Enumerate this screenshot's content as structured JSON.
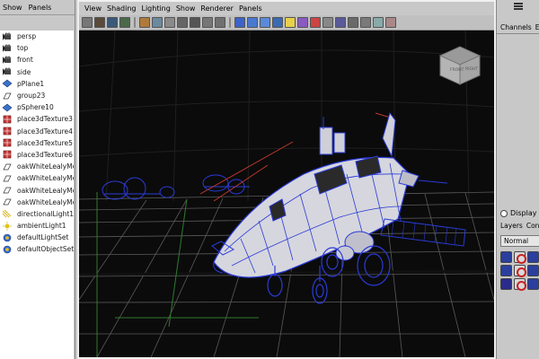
{
  "outliner": {
    "menu": [
      "Show",
      "Panels"
    ],
    "items": [
      {
        "label": "persp",
        "icon": "camera-icon"
      },
      {
        "label": "top",
        "icon": "camera-icon"
      },
      {
        "label": "front",
        "icon": "camera-icon"
      },
      {
        "label": "side",
        "icon": "camera-icon"
      },
      {
        "label": "pPlane1",
        "icon": "polygon-plane-icon"
      },
      {
        "label": "group23",
        "icon": "group-icon"
      },
      {
        "label": "pSphere10",
        "icon": "polygon-plane-icon"
      },
      {
        "label": "place3dTexture3",
        "icon": "texture-cube-icon"
      },
      {
        "label": "place3dTexture4",
        "icon": "texture-cube-icon"
      },
      {
        "label": "place3dTexture5",
        "icon": "texture-cube-icon"
      },
      {
        "label": "place3dTexture6",
        "icon": "texture-cube-icon"
      },
      {
        "label": "oakWhiteLealyMed",
        "icon": "group-icon"
      },
      {
        "label": "oakWhiteLealyMed",
        "icon": "group-icon"
      },
      {
        "label": "oakWhiteLealyMed",
        "icon": "group-icon"
      },
      {
        "label": "oakWhiteLealyMed",
        "icon": "group-icon"
      },
      {
        "label": "directionalLight1",
        "icon": "directional-light-icon"
      },
      {
        "label": "ambientLight1",
        "icon": "ambient-light-icon"
      },
      {
        "label": "defaultLightSet",
        "icon": "set-icon"
      },
      {
        "label": "defaultObjectSet",
        "icon": "set-icon"
      }
    ]
  },
  "viewport": {
    "menu": [
      "View",
      "Shading",
      "Lighting",
      "Show",
      "Renderer",
      "Panels"
    ],
    "viewcube": {
      "left_face": "FRONT",
      "right_face": "RIGHT"
    }
  },
  "right_panel": {
    "tabs": [
      "Channels",
      "E"
    ],
    "display_label": "Display",
    "layer_tabs": [
      "Layers",
      "Con"
    ],
    "blend_mode": "Normal"
  },
  "colors": {
    "viewport_bg": "#0b0b0b",
    "wire_blue": "#2b3bd6",
    "grid": "#6a6a6a",
    "ui_gray": "#c8c8c8"
  }
}
